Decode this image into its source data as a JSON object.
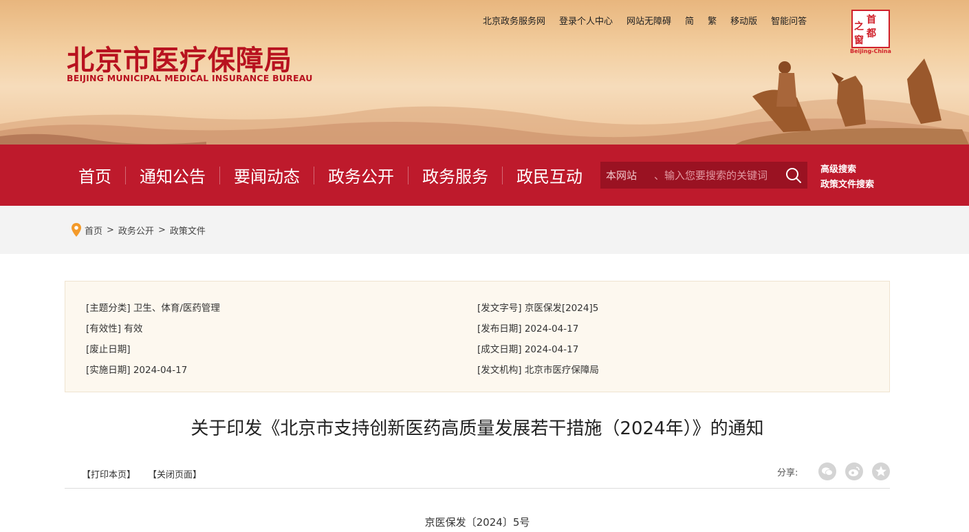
{
  "header": {
    "title_cn": "北京市医疗保障局",
    "title_en": "BEIJING MUNICIPAL MEDICAL INSURANCE BUREAU",
    "top_links": [
      "北京政务服务网",
      "登录个人中心",
      "网站无障碍",
      "简",
      "繁",
      "移动版",
      "智能问答"
    ],
    "seal": {
      "chars": [
        "首",
        "都",
        "之",
        "窗"
      ],
      "caption": "Beijing-China"
    }
  },
  "nav": {
    "items": [
      "首页",
      "通知公告",
      "要闻动态",
      "政务公开",
      "政务服务",
      "政民互动"
    ]
  },
  "search": {
    "scope": "本网站",
    "placeholder": "、输入您要搜索的关键词",
    "links": [
      "高级搜索",
      "政策文件搜索"
    ]
  },
  "breadcrumb": [
    "首页",
    "政务公开",
    "政策文件"
  ],
  "breadcrumb_sep": ">",
  "meta": {
    "left": [
      "[主题分类] 卫生、体育/医药管理",
      "[有效性] 有效",
      "[废止日期]",
      "[实施日期] 2024-04-17"
    ],
    "right": [
      "[发文字号] 京医保发[2024]5",
      "[发布日期] 2024-04-17",
      "[成文日期] 2024-04-17",
      "[发文机构] 北京市医疗保障局"
    ]
  },
  "document": {
    "title": "关于印发《北京市支持创新医药高质量发展若干措施（2024年）》的通知",
    "tools": [
      "【打印本页】",
      "【关闭页面】"
    ],
    "share_label": "分享:",
    "share_icons": [
      "wechat-icon",
      "weibo-icon",
      "star-icon"
    ],
    "number": "京医保发〔2024〕5号"
  },
  "colors": {
    "brand_red": "#be1a2c",
    "search_bg": "#9a1222",
    "meta_bg": "#fdf8ef"
  }
}
